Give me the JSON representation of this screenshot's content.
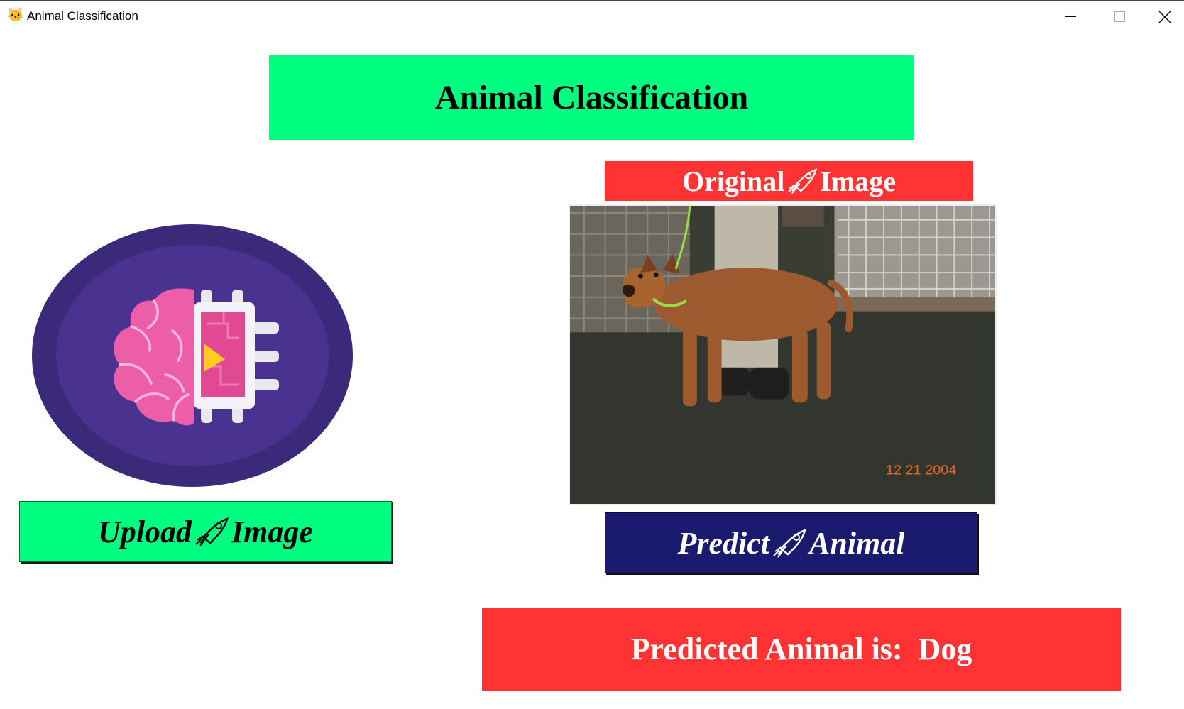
{
  "window": {
    "title": "Animal Classification",
    "app_icon": "cat-face-icon"
  },
  "header": {
    "title": "Animal Classification"
  },
  "upload_button": {
    "label_left": "Upload",
    "label_right": "Image",
    "icon": "rocket-icon"
  },
  "original_image": {
    "label_left": "Original",
    "label_right": "Image",
    "icon": "rocket-icon",
    "photo_timestamp": "12 21 2004"
  },
  "predict_button": {
    "label_left": "Predict",
    "label_right": "Animal",
    "icon": "rocket-icon"
  },
  "result": {
    "text": "Predicted Animal is:  Dog"
  },
  "colors": {
    "accent_green": "#00ff80",
    "accent_red": "#ff3333",
    "navy": "#1a1a6e",
    "logo_purple": "#3b2a7a"
  }
}
